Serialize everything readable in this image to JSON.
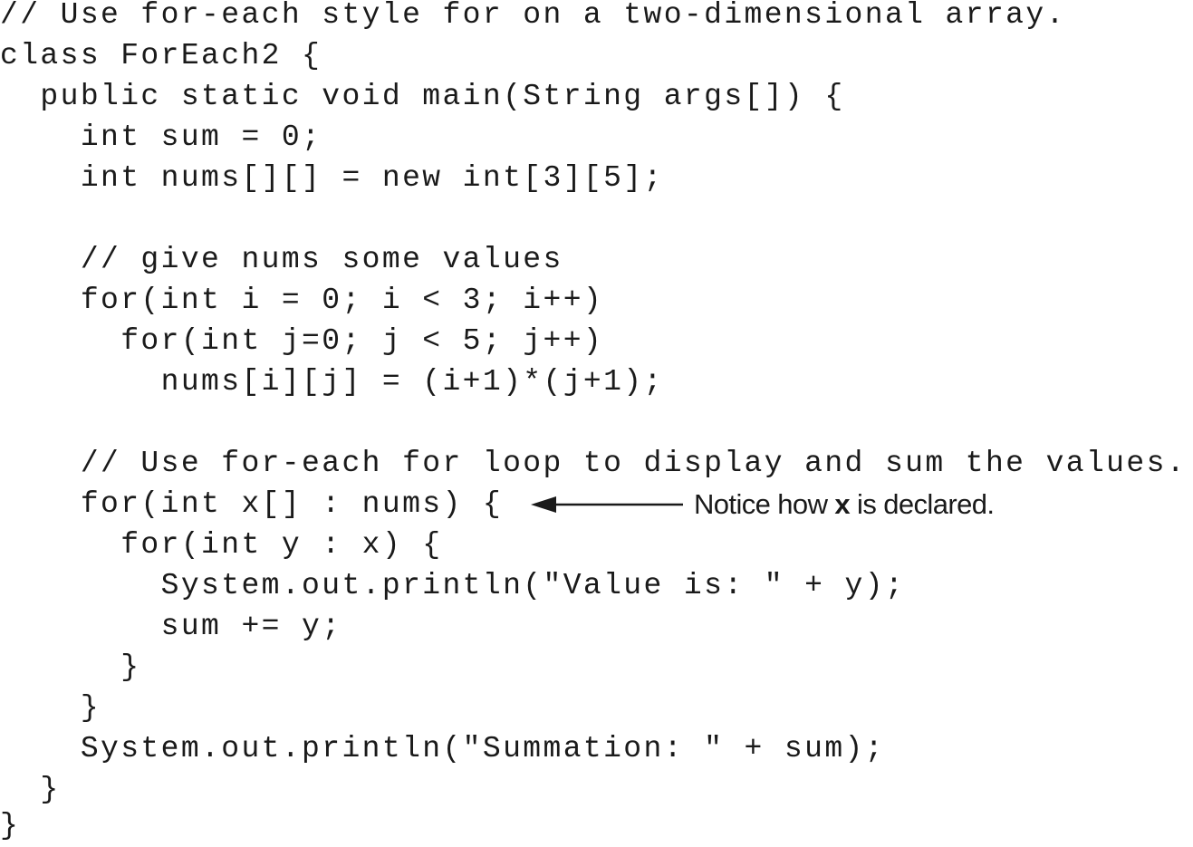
{
  "code": {
    "lines": [
      "// Use for-each style for on a two-dimensional array.",
      "class ForEach2 {",
      "  public static void main(String args[]) {",
      "    int sum = 0;",
      "    int nums[][] = new int[3][5];",
      "",
      "    // give nums some values",
      "    for(int i = 0; i < 3; i++)",
      "      for(int j=0; j < 5; j++)",
      "        nums[i][j] = (i+1)*(j+1);",
      "",
      "    // Use for-each for loop to display and sum the values.",
      "    for(int x[] : nums) {",
      "      for(int y : x) {",
      "        System.out.println(\"Value is: \" + y);",
      "        sum += y;",
      "      }",
      "    }",
      "    System.out.println(\"Summation: \" + sum);",
      "  }",
      "}"
    ]
  },
  "annotation": {
    "prefix": "Notice how ",
    "emphasis": "x",
    "suffix": " is declared."
  }
}
